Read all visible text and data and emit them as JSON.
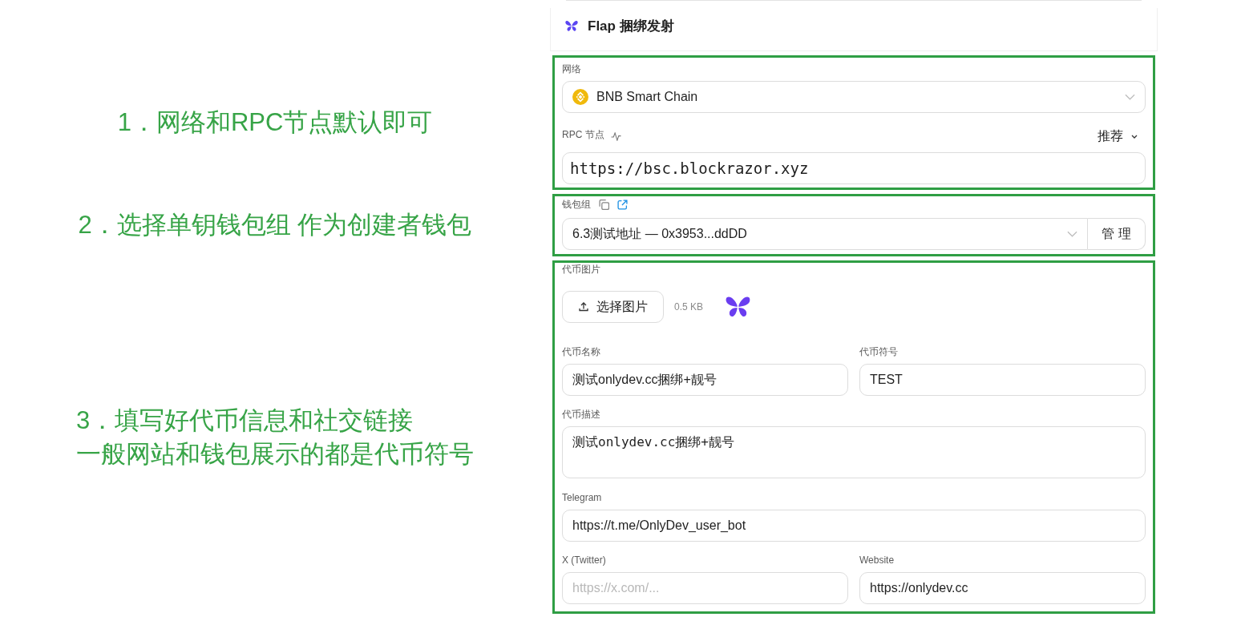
{
  "annotations": [
    {
      "lines": [
        "1．网络和RPC节点默认即可"
      ]
    },
    {
      "lines": [
        "2．选择单钥钱包组 作为创建者钱包"
      ]
    },
    {
      "lines": [
        "3．填写好代币信息和社交链接",
        "一般网站和钱包展示的都是代币符号"
      ]
    }
  ],
  "header": {
    "title": "Flap 捆绑发射"
  },
  "network": {
    "label": "网络",
    "value": "BNB Smart Chain"
  },
  "rpc": {
    "label": "RPC 节点",
    "preset": "推荐",
    "value": "https://bsc.blockrazor.xyz"
  },
  "wallet_group": {
    "label": "钱包组",
    "value": "6.3测试地址 — 0x3953...ddDD",
    "manage_button": "管 理"
  },
  "token_image": {
    "label": "代币图片",
    "button": "选择图片",
    "size": "0.5 KB"
  },
  "token_name": {
    "label": "代币名称",
    "value": "测试onlydev.cc捆绑+靓号"
  },
  "token_symbol": {
    "label": "代币符号",
    "value": "TEST"
  },
  "description": {
    "label": "代币描述",
    "value": "测试onlydev.cc捆绑+靓号"
  },
  "telegram": {
    "label": "Telegram",
    "value": "https://t.me/OnlyDev_user_bot"
  },
  "twitter": {
    "label": "X (Twitter)",
    "placeholder": "https://x.com/..."
  },
  "website": {
    "label": "Website",
    "value": "https://onlydev.cc"
  }
}
